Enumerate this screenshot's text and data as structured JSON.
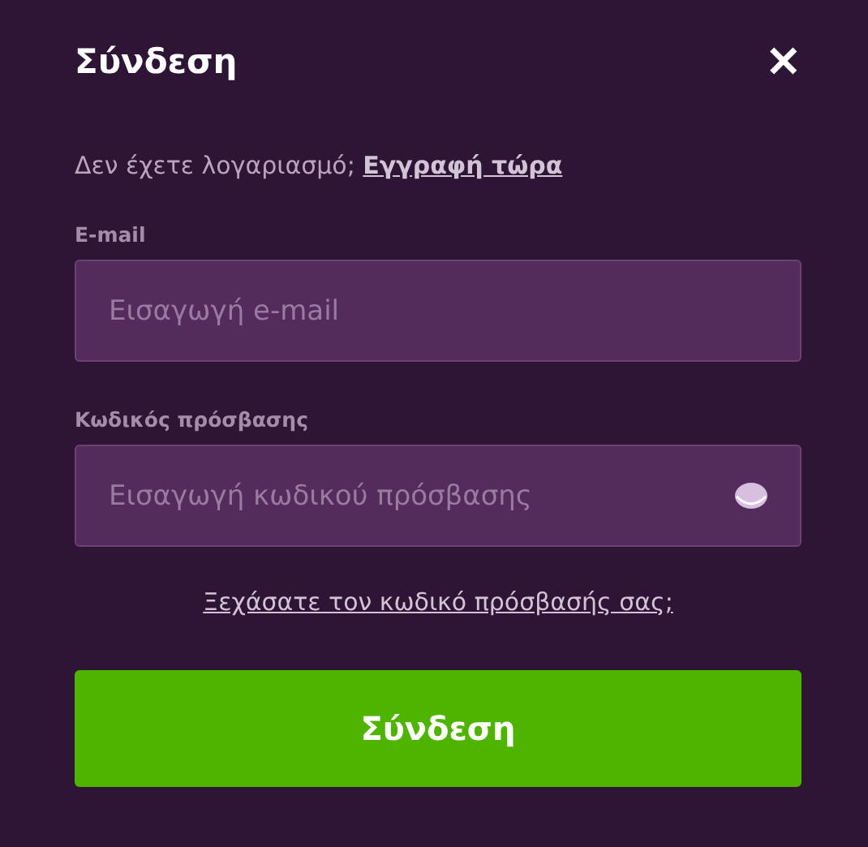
{
  "dialog": {
    "title": "Σύνδεση",
    "close": "✕"
  },
  "signup": {
    "prompt": "Δεν έχετε λογαριασμό;",
    "link": "Εγγραφή τώρα"
  },
  "fields": [
    {
      "label": "E-mail",
      "placeholder": "Εισαγωγή e-mail",
      "kind": "email"
    },
    {
      "label": "Κωδικός πρόσβασης",
      "placeholder": "Εισαγωγή κωδικού πρόσβασης",
      "kind": "password"
    }
  ],
  "forgot_link": "Ξεχάσατε τον κωδικό πρόσβασής σας;",
  "submit": "Σύνδεση"
}
